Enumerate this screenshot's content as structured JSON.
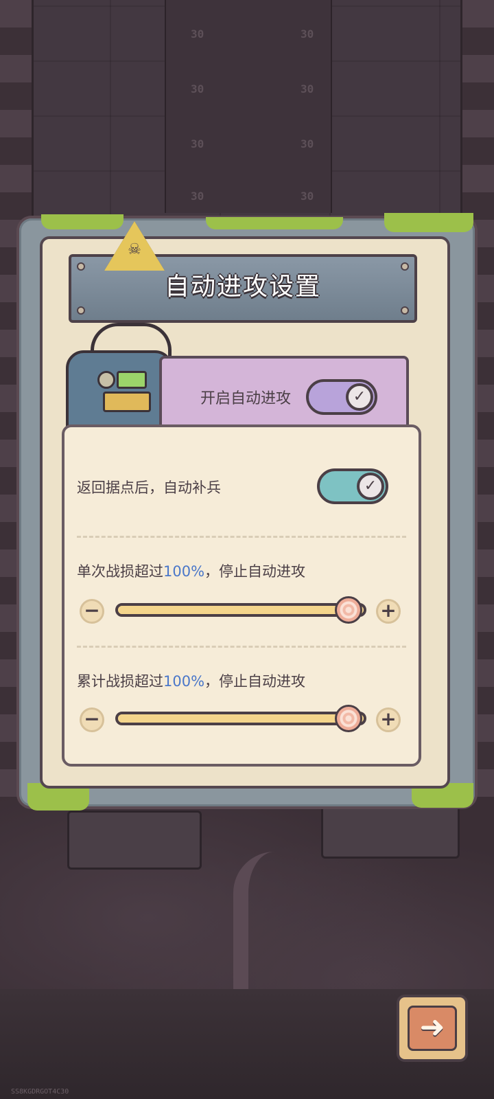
{
  "background": {
    "tile_marks": [
      "30",
      "30",
      "30",
      "30",
      "30",
      "30",
      "30",
      "30"
    ],
    "watermark": "SS8KGDRGOT4C30"
  },
  "dialog": {
    "title": "自动进攻设置",
    "auto_attack": {
      "label": "开启自动进攻",
      "enabled": true,
      "toggle_icon": "check-icon",
      "toggle_color": "#b8a3da"
    },
    "settings": {
      "auto_reinforce": {
        "label": "返回据点后，自动补兵",
        "enabled": true,
        "toggle_icon": "check-icon",
        "toggle_color": "#7ec2c3"
      },
      "single_loss": {
        "prefix": "单次战损超过",
        "value": "100%",
        "suffix": "，停止自动进攻",
        "level": 1.0,
        "minus_icon": "minus-icon",
        "plus_icon": "plus-icon"
      },
      "total_loss": {
        "prefix": "累计战损超过",
        "value": "100%",
        "suffix": "，停止自动进攻",
        "level": 1.0,
        "minus_icon": "minus-icon",
        "plus_icon": "plus-icon"
      }
    }
  },
  "next_button": {
    "icon": "arrow-right-icon"
  },
  "colors": {
    "accent_blue": "#4a77c9",
    "panel_bg": "#ede2c9",
    "slider_fill": "#f4d58c"
  }
}
